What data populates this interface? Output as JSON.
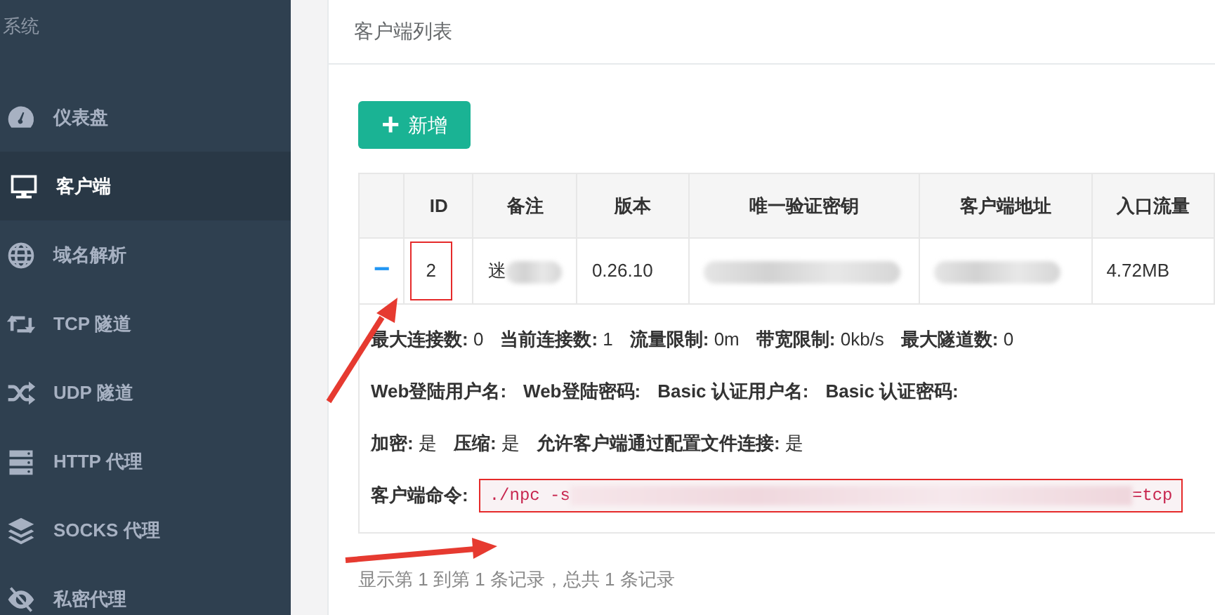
{
  "sidebar": {
    "role": "系统",
    "items": [
      {
        "label": "仪表盘",
        "selected": false
      },
      {
        "label": "客户端",
        "selected": true
      },
      {
        "label": "域名解析",
        "selected": false
      },
      {
        "label": "TCP 隧道",
        "selected": false
      },
      {
        "label": "UDP 隧道",
        "selected": false
      },
      {
        "label": "HTTP 代理",
        "selected": false
      },
      {
        "label": "SOCKS 代理",
        "selected": false
      },
      {
        "label": "私密代理",
        "selected": false
      }
    ]
  },
  "panel": {
    "title": "客户端列表",
    "add_button": {
      "icon": "+",
      "label": "新增"
    }
  },
  "table": {
    "columns": [
      "ID",
      "备注",
      "版本",
      "唯一验证密钥",
      "客户端地址",
      "入口流量"
    ],
    "rows": [
      {
        "expanded": true,
        "toggle": "−",
        "cells": [
          {
            "text": "2",
            "annotated": true
          },
          {
            "text": "迷",
            "redacted": true
          },
          {
            "text": "0.26.10"
          },
          {
            "redacted": true
          },
          {
            "redacted": true
          },
          {
            "text": "4.72MB"
          }
        ]
      }
    ]
  },
  "details": [
    [
      {
        "label": "最大连接数:",
        "value": "0"
      },
      {
        "label": "当前连接数:",
        "value": "1"
      },
      {
        "label": "流量限制:",
        "value": "0m"
      },
      {
        "label": "带宽限制:",
        "value": "0kb/s"
      },
      {
        "label": "最大隧道数:",
        "value": "0"
      }
    ],
    [
      {
        "label": "Web登陆用户名:"
      },
      {
        "label": "Web登陆密码:"
      },
      {
        "label": "Basic 认证用户名:"
      },
      {
        "label": "Basic 认证密码:"
      }
    ],
    [
      {
        "label": "加密:",
        "value": "是"
      },
      {
        "label": "压缩:",
        "value": "是"
      },
      {
        "label": "允许客户端通过配置文件连接:",
        "value": "是"
      }
    ]
  ],
  "command": {
    "label": "客户端命令:",
    "start": "./npc -s",
    "end": "=tcp",
    "annotated": true
  },
  "footer": "显示第 1 到第 1 条记录，总共 1 条记录"
}
